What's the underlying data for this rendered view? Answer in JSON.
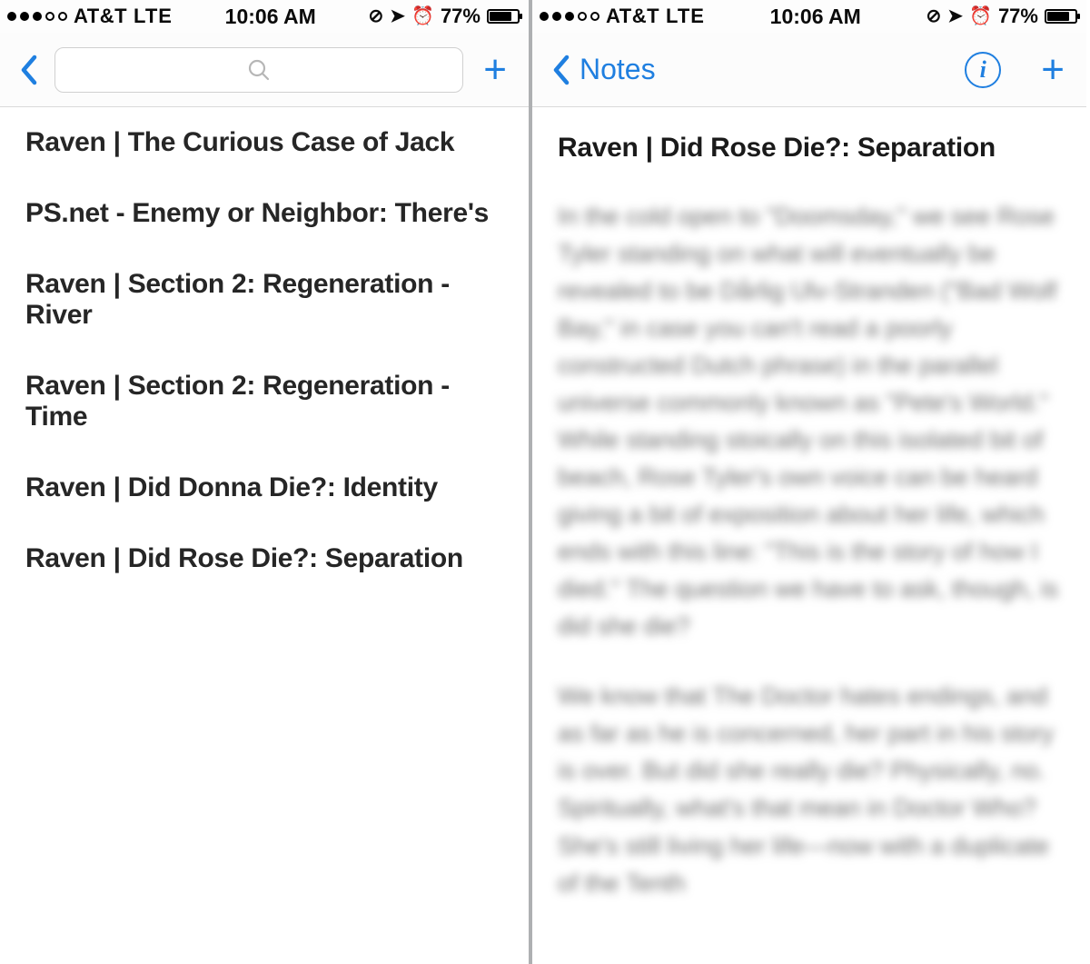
{
  "status": {
    "carrier": "AT&T",
    "network": "LTE",
    "time": "10:06 AM",
    "battery_pct": "77%"
  },
  "left": {
    "search_placeholder": "",
    "items": [
      "Raven | The Curious Case of Jack",
      "PS.net  - Enemy or Neighbor: There's",
      "Raven | Section 2: Regeneration - River",
      "Raven | Section 2: Regeneration - Time",
      "Raven | Did Donna Die?: Identity",
      "Raven | Did Rose Die?: Separation"
    ]
  },
  "right": {
    "back_label": "Notes",
    "title": "Raven | Did Rose Die?: Separation",
    "body_p1": "In the cold open to \"Doomsday,\" we see Rose Tyler standing on what will eventually be revealed to be Dårlig Ulv-Stranden (\"Bad Wolf Bay,\" in case you can't read a poorly constructed Dutch phrase) in the parallel universe commonly known as \"Pete's World.\" While standing stoically on this isolated bit of beach, Rose Tyler's own voice can be heard giving a bit of exposition about her life, which ends with this line: \"This is the story of how I died.\" The question we have to ask, though, is did she die?",
    "body_p2": "We know that The Doctor hates endings, and as far as he is concerned, her part in his story is over. But did she really die? Physically, no. Spiritually, what's that mean in Doctor Who? She's still living her life—now with a duplicate of the Tenth"
  }
}
